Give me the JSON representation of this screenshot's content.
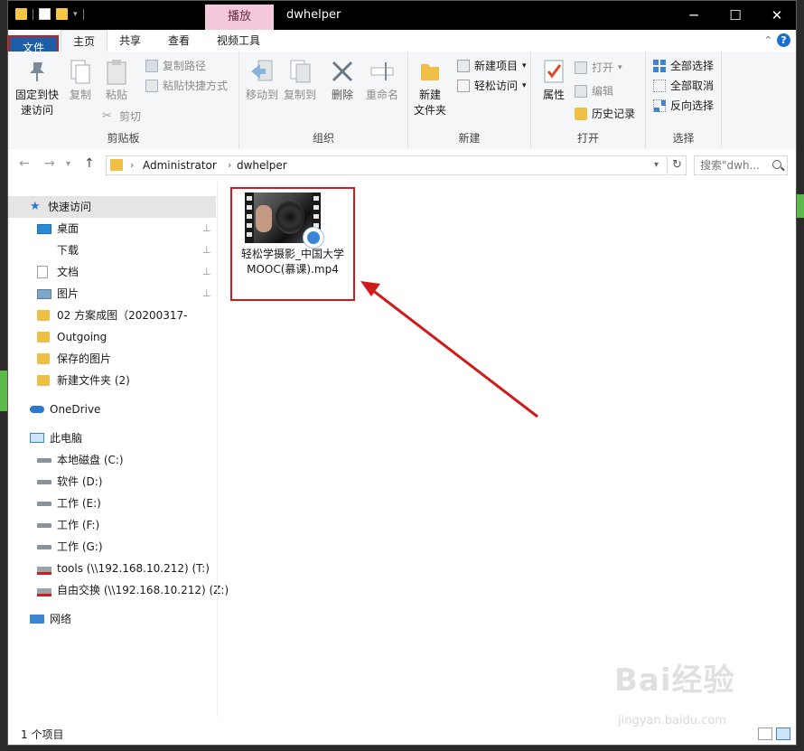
{
  "window": {
    "title": "dwhelper",
    "context_tab": "播放",
    "controls": {
      "minimize": "─",
      "maximize": "☐",
      "close": "✕"
    }
  },
  "ribbon_tabs": {
    "file": "文件",
    "home": "主页",
    "share": "共享",
    "view": "查看",
    "video_tools": "视频工具"
  },
  "ribbon": {
    "clipboard": {
      "group_label": "剪贴板",
      "pin_quick_access": "固定到快\n速访问",
      "copy": "复制",
      "paste": "粘贴",
      "copy_path": "复制路径",
      "paste_shortcut": "粘贴快捷方式",
      "cut": "剪切"
    },
    "organize": {
      "group_label": "组织",
      "move_to": "移动到",
      "copy_to": "复制到",
      "delete": "删除",
      "rename": "重命名"
    },
    "new": {
      "group_label": "新建",
      "new_folder": "新建\n文件夹",
      "new_item": "新建项目",
      "easy_access": "轻松访问"
    },
    "open": {
      "group_label": "打开",
      "properties": "属性",
      "open": "打开",
      "edit": "编辑",
      "history": "历史记录"
    },
    "select": {
      "group_label": "选择",
      "select_all": "全部选择",
      "select_none": "全部取消",
      "invert": "反向选择"
    }
  },
  "address": {
    "crumbs": [
      "Administrator",
      "dwhelper"
    ],
    "search_placeholder": "搜索\"dwh..."
  },
  "nav": {
    "quick_access": "快速访问",
    "items": [
      {
        "label": "桌面",
        "pinned": true
      },
      {
        "label": "下载",
        "pinned": true
      },
      {
        "label": "文档",
        "pinned": true
      },
      {
        "label": "图片",
        "pinned": true
      },
      {
        "label": "02 方案成图（20200317-",
        "pinned": false
      },
      {
        "label": "Outgoing",
        "pinned": false
      },
      {
        "label": "保存的图片",
        "pinned": false
      },
      {
        "label": "新建文件夹 (2)",
        "pinned": false
      }
    ],
    "onedrive": "OneDrive",
    "this_pc": "此电脑",
    "drives": [
      "本地磁盘 (C:)",
      "软件 (D:)",
      "工作 (E:)",
      "工作 (F:)",
      "工作 (G:)",
      "tools (\\\\192.168.10.212) (T:)",
      "自由交换 (\\\\192.168.10.212) (Z:)"
    ],
    "network": "网络",
    "pin_glyph": "📌"
  },
  "content": {
    "file_name": "轻松学摄影_中国大学MOOC(慕课).mp4"
  },
  "status": {
    "item_count": "1 个项目"
  },
  "watermark": {
    "brand": "Bai经验",
    "url": "jingyan.baidu.com"
  },
  "colors": {
    "file_tab": "#1c5fa8",
    "context_tab": "#f4c8dc",
    "highlight_box": "#d11a1a",
    "arrow": "#d11a1a"
  }
}
